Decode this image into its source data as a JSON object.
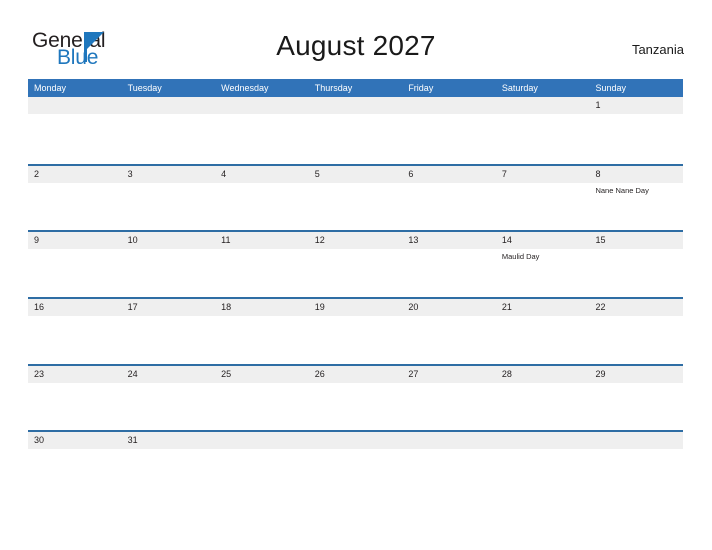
{
  "brand": {
    "name_part1": "General",
    "name_part2": "Blue",
    "logo_icon": "triangle-flag-icon",
    "color_primary": "#1f77bd",
    "color_dark": "#231f20"
  },
  "header": {
    "title": "August 2027",
    "country": "Tanzania"
  },
  "theme": {
    "header_blue": "#3173b8",
    "rule_blue": "#2e6da4",
    "band_gray": "#efefef",
    "cell_white": "#fdfdfd"
  },
  "calendar": {
    "month": "August",
    "year": "2027",
    "weekday_headers": [
      "Monday",
      "Tuesday",
      "Wednesday",
      "Thursday",
      "Friday",
      "Saturday",
      "Sunday"
    ],
    "weeks": [
      [
        {
          "day": ""
        },
        {
          "day": ""
        },
        {
          "day": ""
        },
        {
          "day": ""
        },
        {
          "day": ""
        },
        {
          "day": ""
        },
        {
          "day": "1"
        }
      ],
      [
        {
          "day": "2"
        },
        {
          "day": "3"
        },
        {
          "day": "4"
        },
        {
          "day": "5"
        },
        {
          "day": "6"
        },
        {
          "day": "7"
        },
        {
          "day": "8",
          "event": "Nane Nane Day"
        }
      ],
      [
        {
          "day": "9"
        },
        {
          "day": "10"
        },
        {
          "day": "11"
        },
        {
          "day": "12"
        },
        {
          "day": "13"
        },
        {
          "day": "14",
          "event": "Maulid Day"
        },
        {
          "day": "15"
        }
      ],
      [
        {
          "day": "16"
        },
        {
          "day": "17"
        },
        {
          "day": "18"
        },
        {
          "day": "19"
        },
        {
          "day": "20"
        },
        {
          "day": "21"
        },
        {
          "day": "22"
        }
      ],
      [
        {
          "day": "23"
        },
        {
          "day": "24"
        },
        {
          "day": "25"
        },
        {
          "day": "26"
        },
        {
          "day": "27"
        },
        {
          "day": "28"
        },
        {
          "day": "29"
        }
      ],
      [
        {
          "day": "30"
        },
        {
          "day": "31"
        },
        {
          "day": ""
        },
        {
          "day": ""
        },
        {
          "day": ""
        },
        {
          "day": ""
        },
        {
          "day": ""
        }
      ]
    ],
    "holidays": [
      {
        "date": "8",
        "name": "Nane Nane Day"
      },
      {
        "date": "14",
        "name": "Maulid Day"
      }
    ]
  }
}
